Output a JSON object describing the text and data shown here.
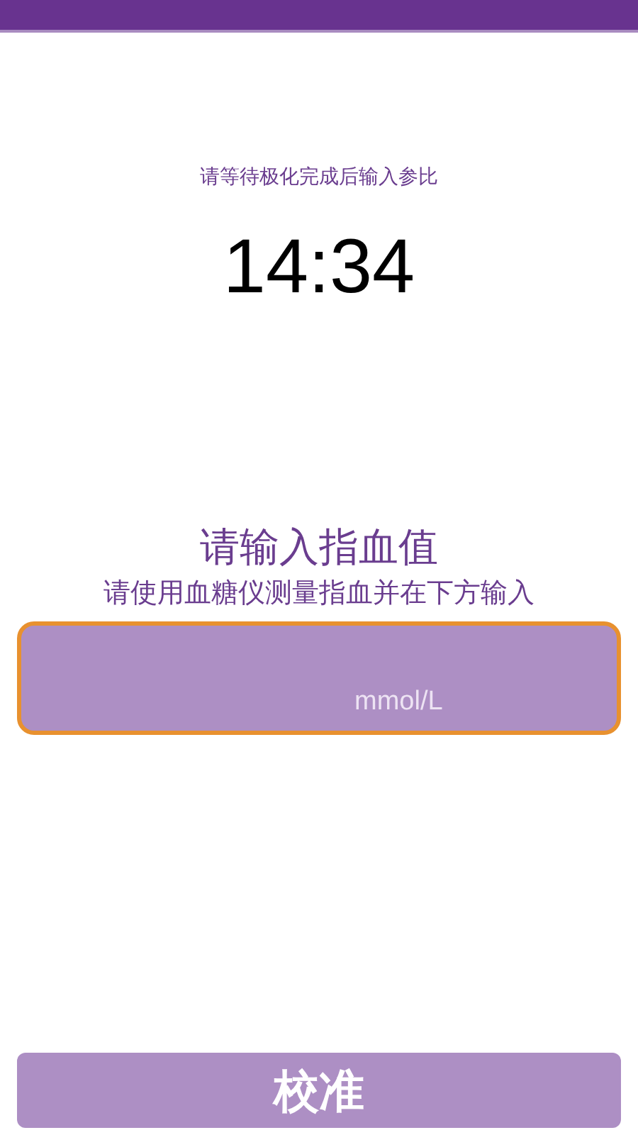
{
  "status_text": "请等待极化完成后输入参比",
  "timer": "14:34",
  "prompt": {
    "title": "请输入指血值",
    "subtitle": "请使用血糖仪测量指血并在下方输入"
  },
  "input": {
    "unit": "mmol/L"
  },
  "submit_button": "校准"
}
